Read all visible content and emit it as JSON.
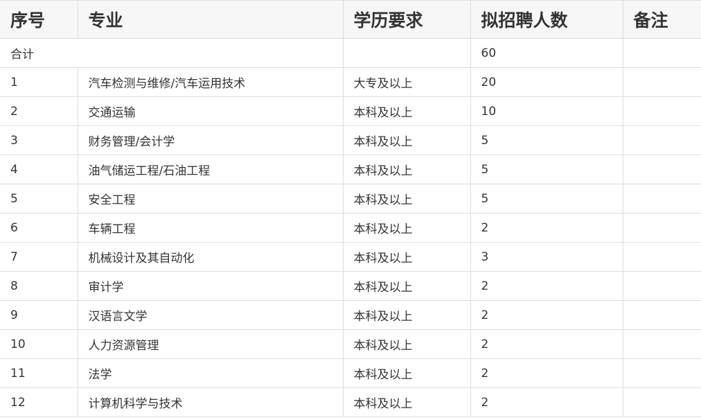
{
  "table": {
    "headers": [
      "序号",
      "专业",
      "学历要求",
      "拟招聘人数",
      "备注"
    ],
    "total_row": {
      "label": "合计",
      "education": "",
      "count": "60",
      "note": ""
    },
    "rows": [
      [
        "1",
        "汽车检测与维修/汽车运用技术",
        "大专及以上",
        "20",
        ""
      ],
      [
        "2",
        "交通运输",
        "本科及以上",
        "10",
        ""
      ],
      [
        "3",
        "财务管理/会计学",
        "本科及以上",
        "5",
        ""
      ],
      [
        "4",
        "油气储运工程/石油工程",
        "本科及以上",
        "5",
        ""
      ],
      [
        "5",
        "安全工程",
        "本科及以上",
        "5",
        ""
      ],
      [
        "6",
        "车辆工程",
        "本科及以上",
        "2",
        ""
      ],
      [
        "7",
        "机械设计及其自动化",
        "本科及以上",
        "3",
        ""
      ],
      [
        "8",
        "审计学",
        "本科及以上",
        "2",
        ""
      ],
      [
        "9",
        "汉语言文学",
        "本科及以上",
        "2",
        ""
      ],
      [
        "10",
        "人力资源管理",
        "本科及以上",
        "2",
        ""
      ],
      [
        "11",
        "法学",
        "本科及以上",
        "2",
        ""
      ],
      [
        "12",
        "计算机科学与技术",
        "本科及以上",
        "2",
        ""
      ]
    ]
  },
  "colors": {
    "border": "#dcdcdc",
    "header_bg": "#f7f7f7",
    "text": "#333333"
  }
}
